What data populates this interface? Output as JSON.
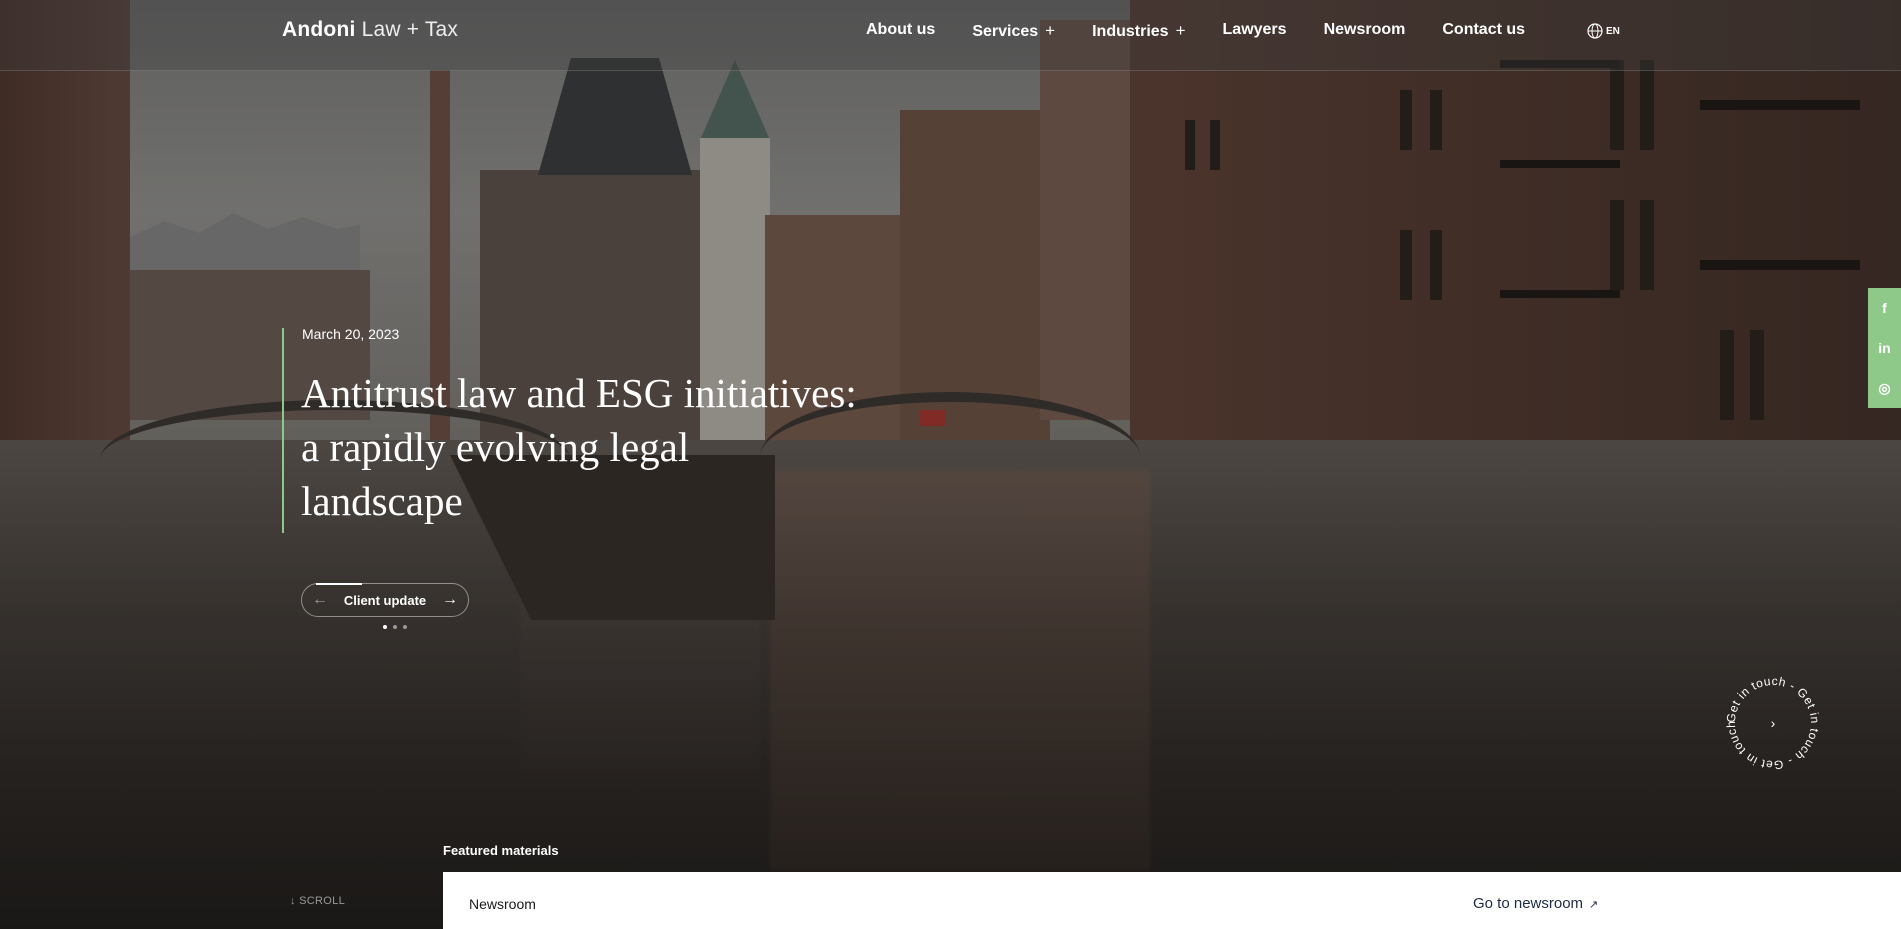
{
  "header": {
    "logo_bold": "Andoni",
    "logo_light": "Law + Tax",
    "nav": [
      {
        "label": "About us",
        "plus": ""
      },
      {
        "label": "Services",
        "plus": "+"
      },
      {
        "label": "Industries",
        "plus": "+"
      },
      {
        "label": "Lawyers",
        "plus": ""
      },
      {
        "label": "Newsroom",
        "plus": ""
      },
      {
        "label": "Contact us",
        "plus": ""
      }
    ],
    "language": "EN",
    "language_icon": "globe-icon"
  },
  "hero": {
    "date": "March 20, 2023",
    "title_lines": [
      "Antitrust law and ESG initiatives:",
      "a rapidly evolving legal",
      "landscape"
    ],
    "category": "Client update",
    "prev_icon": "arrow-left-icon",
    "next_icon": "arrow-right-icon",
    "slides_total": 3,
    "slide_active": 1,
    "accent_color": "#8fc98a"
  },
  "social": [
    {
      "label": "f",
      "icon": "facebook-icon"
    },
    {
      "label": "in",
      "icon": "linkedin-icon"
    },
    {
      "label": "◎",
      "icon": "instagram-icon"
    }
  ],
  "get_in_touch": {
    "text": "Get in touch - Get in touch - Get in touch - ",
    "icon": "chevron-right-icon"
  },
  "scroll": {
    "label": "SCROLL",
    "icon": "arrow-down-icon"
  },
  "featured": {
    "heading": "Featured materials",
    "panel_title": "Newsroom",
    "panel_link": "Go to newsroom",
    "panel_link_icon": "arrow-up-right-icon"
  }
}
